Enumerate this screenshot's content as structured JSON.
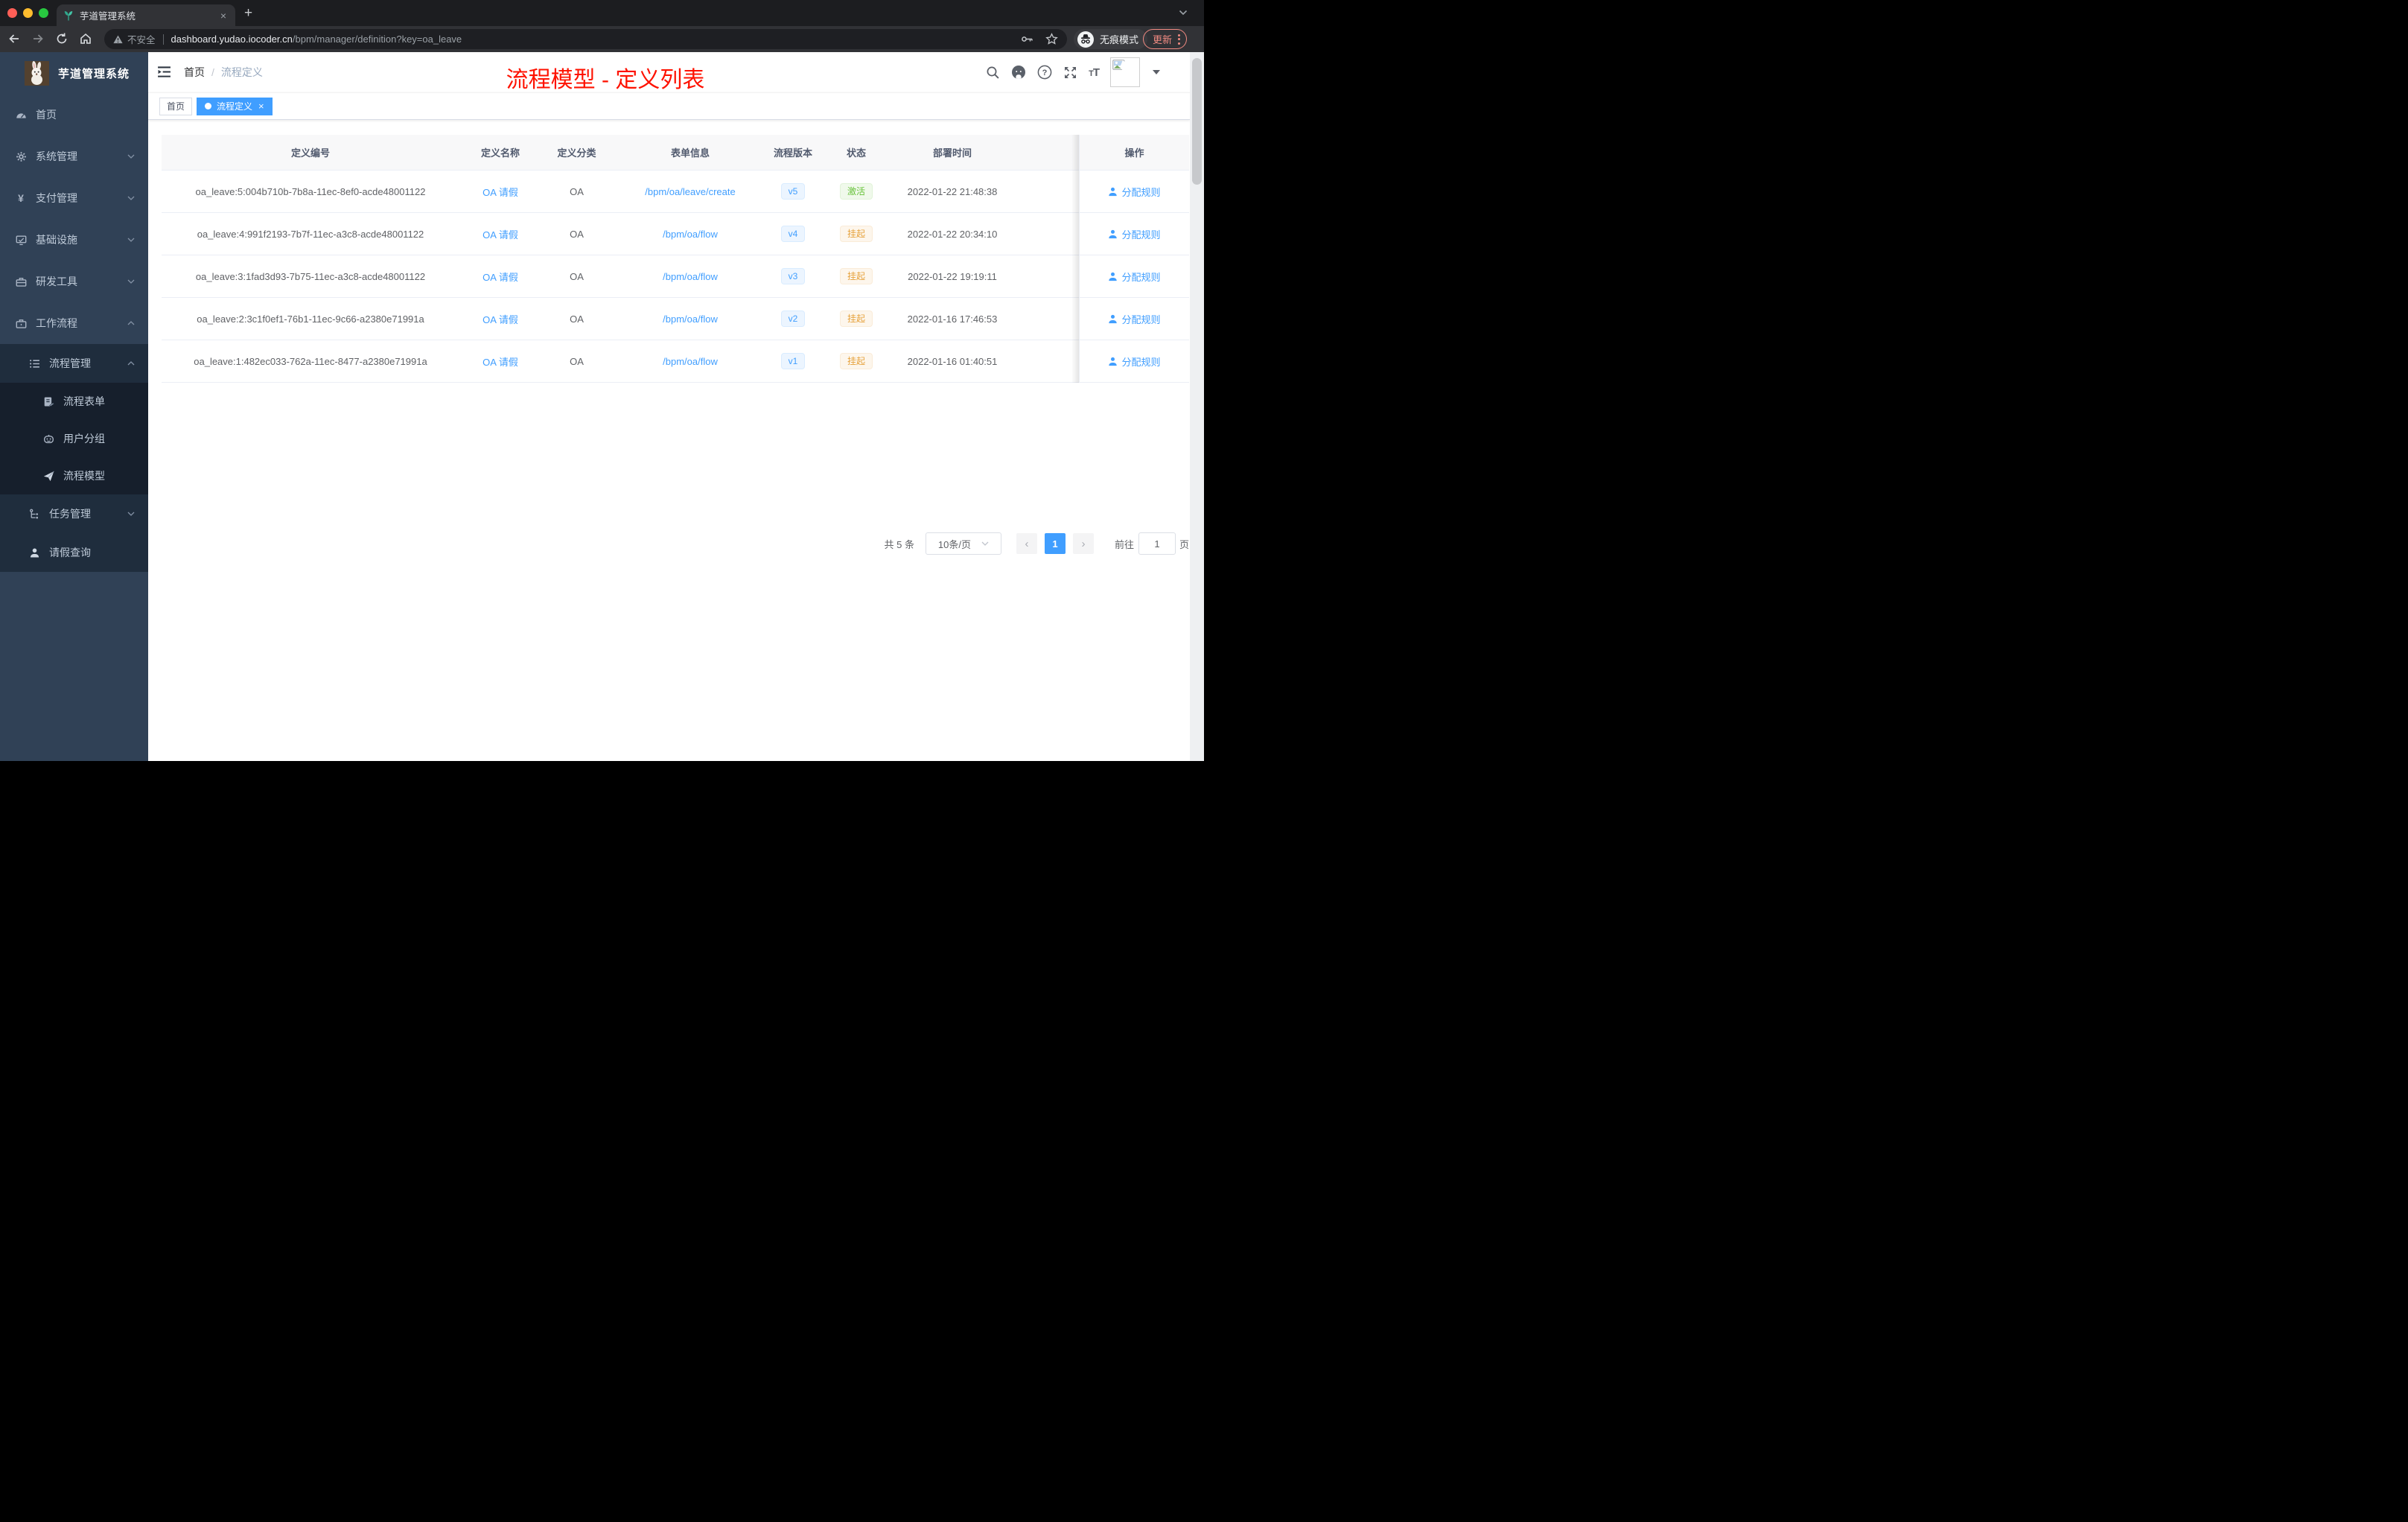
{
  "colors": {
    "accent": "#409eff",
    "annotation": "#fe1200",
    "status_active": "#67c23a",
    "status_suspended": "#e6a23c",
    "sidebar_bg": "#304156",
    "submenu_bg": "#1f2d3d"
  },
  "browser": {
    "tab_title": "芋道管理系统",
    "tab_close": "×",
    "new_tab": "+",
    "security_label": "不安全",
    "url_domain": "dashboard.yudao.iocoder.cn",
    "url_path": "/bpm/manager/definition?key=oa_leave",
    "incognito_label": "无痕模式",
    "update_label": "更新"
  },
  "sidebar": {
    "logo_title": "芋道管理系统",
    "items": {
      "home": "首页",
      "system": "系统管理",
      "pay": "支付管理",
      "infra": "基础设施",
      "dev": "研发工具",
      "workflow": "工作流程",
      "process_mgmt": "流程管理",
      "process_form": "流程表单",
      "user_group": "用户分组",
      "process_model": "流程模型",
      "task_mgmt": "任务管理",
      "leave_query": "请假查询"
    }
  },
  "header": {
    "breadcrumb_home": "首页",
    "breadcrumb_sep": "/",
    "breadcrumb_current": "流程定义",
    "annotation": "流程模型 - 定义列表"
  },
  "tags": {
    "home": "首页",
    "current": "流程定义",
    "close": "×"
  },
  "table": {
    "col_id": "定义编号",
    "col_name": "定义名称",
    "col_category": "定义分类",
    "col_form": "表单信息",
    "col_version": "流程版本",
    "col_status": "状态",
    "col_deploy": "部署时间",
    "col_action": "操作",
    "rows": [
      {
        "id": "oa_leave:5:004b710b-7b8a-11ec-8ef0-acde48001122",
        "name": "OA 请假",
        "category": "OA",
        "form": "/bpm/oa/leave/create",
        "version": "v5",
        "status": "激活",
        "deploy_time": "2022-01-22 21:48:38",
        "action": "分配规则"
      },
      {
        "id": "oa_leave:4:991f2193-7b7f-11ec-a3c8-acde48001122",
        "name": "OA 请假",
        "category": "OA",
        "form": "/bpm/oa/flow",
        "version": "v4",
        "status": "挂起",
        "deploy_time": "2022-01-22 20:34:10",
        "action": "分配规则"
      },
      {
        "id": "oa_leave:3:1fad3d93-7b75-11ec-a3c8-acde48001122",
        "name": "OA 请假",
        "category": "OA",
        "form": "/bpm/oa/flow",
        "version": "v3",
        "status": "挂起",
        "deploy_time": "2022-01-22 19:19:11",
        "action": "分配规则"
      },
      {
        "id": "oa_leave:2:3c1f0ef1-76b1-11ec-9c66-a2380e71991a",
        "name": "OA 请假",
        "category": "OA",
        "form": "/bpm/oa/flow",
        "version": "v2",
        "status": "挂起",
        "deploy_time": "2022-01-16 17:46:53",
        "action": "分配规则"
      },
      {
        "id": "oa_leave:1:482ec033-762a-11ec-8477-a2380e71991a",
        "name": "OA 请假",
        "category": "OA",
        "form": "/bpm/oa/flow",
        "version": "v1",
        "status": "挂起",
        "deploy_time": "2022-01-16 01:40:51",
        "action": "分配规则"
      }
    ]
  },
  "pagination": {
    "total": "共 5 条",
    "page_size": "10条/页",
    "prev": "‹",
    "current": "1",
    "next": "›",
    "goto": "前往",
    "goto_value": "1",
    "unit": "页"
  }
}
